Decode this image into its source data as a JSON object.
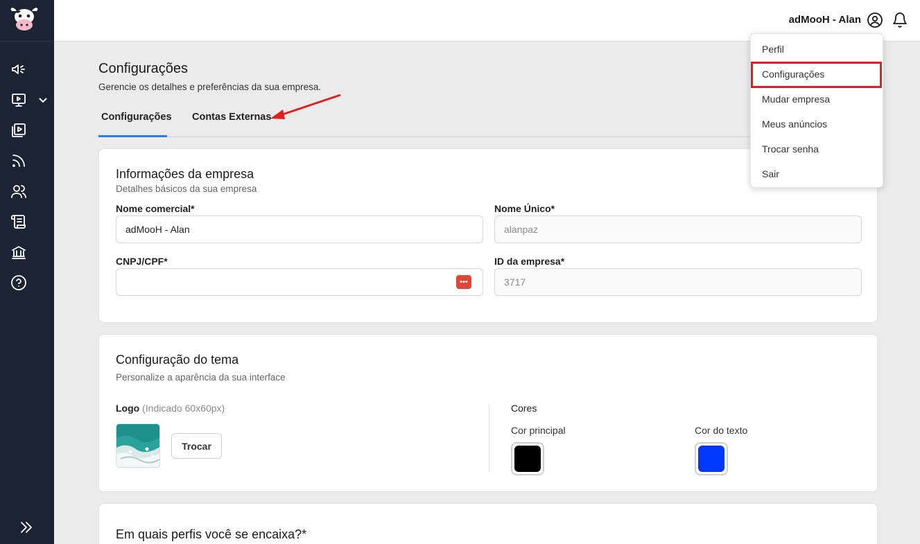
{
  "header": {
    "user_name": "adMooH - Alan"
  },
  "page": {
    "title": "Configurações",
    "subtitle": "Gerencie os detalhes e preferências da sua empresa."
  },
  "tabs": [
    {
      "label": "Configurações",
      "active": true
    },
    {
      "label": "Contas Externas",
      "active": false
    }
  ],
  "company_info": {
    "title": "Informações da empresa",
    "subtitle": "Detalhes básicos da sua empresa",
    "trade_name_label": "Nome comercial*",
    "trade_name_value": "adMooH - Alan",
    "unique_name_label": "Nome Único*",
    "unique_name_value": "alanpaz",
    "cnpj_label": "CNPJ/CPF*",
    "cnpj_value": "",
    "company_id_label": "ID da empresa*",
    "company_id_value": "3717"
  },
  "theme": {
    "title": "Configuração do tema",
    "subtitle": "Personalize a aparência da sua interface",
    "logo_label": "Logo",
    "logo_hint": "(Indicado 60x60px)",
    "swap_button": "Trocar",
    "colors_label": "Cores",
    "primary_color_label": "Cor principal",
    "primary_color": "#000000",
    "text_color_label": "Cor do texto",
    "text_color": "#0038ff"
  },
  "profiles": {
    "title": "Em quais perfis você se encaixa?*"
  },
  "dropdown": {
    "items": [
      "Perfil",
      "Configurações",
      "Mudar empresa",
      "Meus anúncios",
      "Trocar senha",
      "Sair"
    ],
    "highlighted": "Configurações"
  },
  "colors": {
    "sidebar_bg": "#1c2333",
    "accent": "#2f7be5",
    "annotation": "#e02020"
  }
}
